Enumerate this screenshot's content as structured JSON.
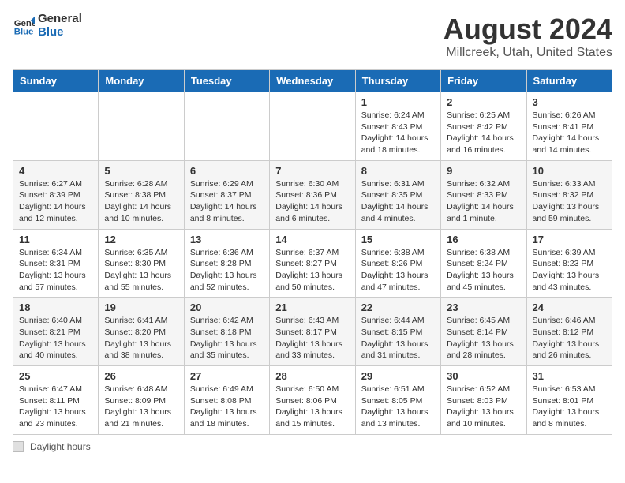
{
  "header": {
    "logo_general": "General",
    "logo_blue": "Blue",
    "title": "August 2024",
    "subtitle": "Millcreek, Utah, United States"
  },
  "calendar": {
    "days_of_week": [
      "Sunday",
      "Monday",
      "Tuesday",
      "Wednesday",
      "Thursday",
      "Friday",
      "Saturday"
    ],
    "weeks": [
      [
        {
          "day": "",
          "info": ""
        },
        {
          "day": "",
          "info": ""
        },
        {
          "day": "",
          "info": ""
        },
        {
          "day": "",
          "info": ""
        },
        {
          "day": "1",
          "info": "Sunrise: 6:24 AM\nSunset: 8:43 PM\nDaylight: 14 hours\nand 18 minutes."
        },
        {
          "day": "2",
          "info": "Sunrise: 6:25 AM\nSunset: 8:42 PM\nDaylight: 14 hours\nand 16 minutes."
        },
        {
          "day": "3",
          "info": "Sunrise: 6:26 AM\nSunset: 8:41 PM\nDaylight: 14 hours\nand 14 minutes."
        }
      ],
      [
        {
          "day": "4",
          "info": "Sunrise: 6:27 AM\nSunset: 8:39 PM\nDaylight: 14 hours\nand 12 minutes."
        },
        {
          "day": "5",
          "info": "Sunrise: 6:28 AM\nSunset: 8:38 PM\nDaylight: 14 hours\nand 10 minutes."
        },
        {
          "day": "6",
          "info": "Sunrise: 6:29 AM\nSunset: 8:37 PM\nDaylight: 14 hours\nand 8 minutes."
        },
        {
          "day": "7",
          "info": "Sunrise: 6:30 AM\nSunset: 8:36 PM\nDaylight: 14 hours\nand 6 minutes."
        },
        {
          "day": "8",
          "info": "Sunrise: 6:31 AM\nSunset: 8:35 PM\nDaylight: 14 hours\nand 4 minutes."
        },
        {
          "day": "9",
          "info": "Sunrise: 6:32 AM\nSunset: 8:33 PM\nDaylight: 14 hours\nand 1 minute."
        },
        {
          "day": "10",
          "info": "Sunrise: 6:33 AM\nSunset: 8:32 PM\nDaylight: 13 hours\nand 59 minutes."
        }
      ],
      [
        {
          "day": "11",
          "info": "Sunrise: 6:34 AM\nSunset: 8:31 PM\nDaylight: 13 hours\nand 57 minutes."
        },
        {
          "day": "12",
          "info": "Sunrise: 6:35 AM\nSunset: 8:30 PM\nDaylight: 13 hours\nand 55 minutes."
        },
        {
          "day": "13",
          "info": "Sunrise: 6:36 AM\nSunset: 8:28 PM\nDaylight: 13 hours\nand 52 minutes."
        },
        {
          "day": "14",
          "info": "Sunrise: 6:37 AM\nSunset: 8:27 PM\nDaylight: 13 hours\nand 50 minutes."
        },
        {
          "day": "15",
          "info": "Sunrise: 6:38 AM\nSunset: 8:26 PM\nDaylight: 13 hours\nand 47 minutes."
        },
        {
          "day": "16",
          "info": "Sunrise: 6:38 AM\nSunset: 8:24 PM\nDaylight: 13 hours\nand 45 minutes."
        },
        {
          "day": "17",
          "info": "Sunrise: 6:39 AM\nSunset: 8:23 PM\nDaylight: 13 hours\nand 43 minutes."
        }
      ],
      [
        {
          "day": "18",
          "info": "Sunrise: 6:40 AM\nSunset: 8:21 PM\nDaylight: 13 hours\nand 40 minutes."
        },
        {
          "day": "19",
          "info": "Sunrise: 6:41 AM\nSunset: 8:20 PM\nDaylight: 13 hours\nand 38 minutes."
        },
        {
          "day": "20",
          "info": "Sunrise: 6:42 AM\nSunset: 8:18 PM\nDaylight: 13 hours\nand 35 minutes."
        },
        {
          "day": "21",
          "info": "Sunrise: 6:43 AM\nSunset: 8:17 PM\nDaylight: 13 hours\nand 33 minutes."
        },
        {
          "day": "22",
          "info": "Sunrise: 6:44 AM\nSunset: 8:15 PM\nDaylight: 13 hours\nand 31 minutes."
        },
        {
          "day": "23",
          "info": "Sunrise: 6:45 AM\nSunset: 8:14 PM\nDaylight: 13 hours\nand 28 minutes."
        },
        {
          "day": "24",
          "info": "Sunrise: 6:46 AM\nSunset: 8:12 PM\nDaylight: 13 hours\nand 26 minutes."
        }
      ],
      [
        {
          "day": "25",
          "info": "Sunrise: 6:47 AM\nSunset: 8:11 PM\nDaylight: 13 hours\nand 23 minutes."
        },
        {
          "day": "26",
          "info": "Sunrise: 6:48 AM\nSunset: 8:09 PM\nDaylight: 13 hours\nand 21 minutes."
        },
        {
          "day": "27",
          "info": "Sunrise: 6:49 AM\nSunset: 8:08 PM\nDaylight: 13 hours\nand 18 minutes."
        },
        {
          "day": "28",
          "info": "Sunrise: 6:50 AM\nSunset: 8:06 PM\nDaylight: 13 hours\nand 15 minutes."
        },
        {
          "day": "29",
          "info": "Sunrise: 6:51 AM\nSunset: 8:05 PM\nDaylight: 13 hours\nand 13 minutes."
        },
        {
          "day": "30",
          "info": "Sunrise: 6:52 AM\nSunset: 8:03 PM\nDaylight: 13 hours\nand 10 minutes."
        },
        {
          "day": "31",
          "info": "Sunrise: 6:53 AM\nSunset: 8:01 PM\nDaylight: 13 hours\nand 8 minutes."
        }
      ]
    ]
  },
  "legend": {
    "box_label": "Daylight hours"
  }
}
